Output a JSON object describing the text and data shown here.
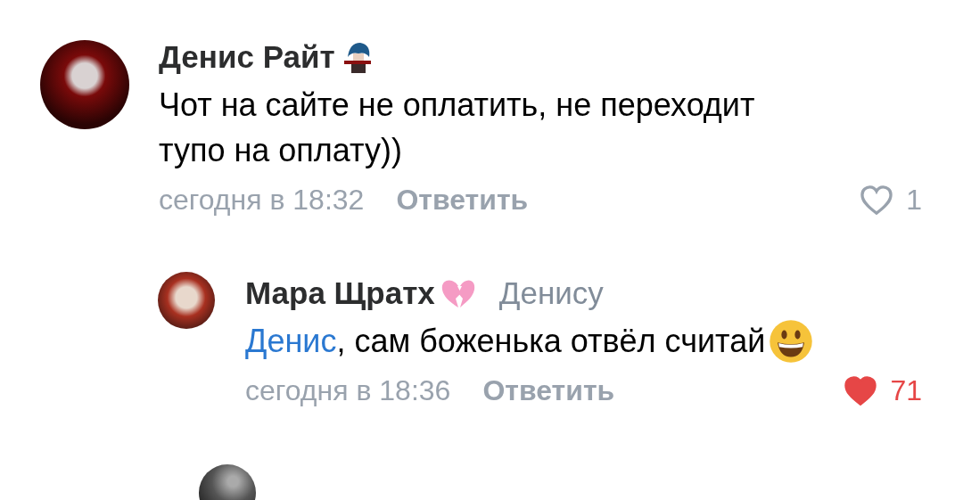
{
  "comments": [
    {
      "author": "Денис Райт",
      "text": "Чот на сайте не оплатить, не переходит тупо на оплату))",
      "emoji_end": false,
      "time": "сегодня в 18:32",
      "reply": "Ответить",
      "liked": false,
      "likes": "1",
      "kind": "top"
    },
    {
      "author": "Мара Щратх",
      "reply_to": "Денису",
      "mention": "Денис",
      "text": ", сам боженька отвёл считай",
      "emoji_end": true,
      "time": "сегодня в 18:36",
      "reply": "Ответить",
      "liked": true,
      "likes": "71",
      "kind": "reply"
    }
  ]
}
